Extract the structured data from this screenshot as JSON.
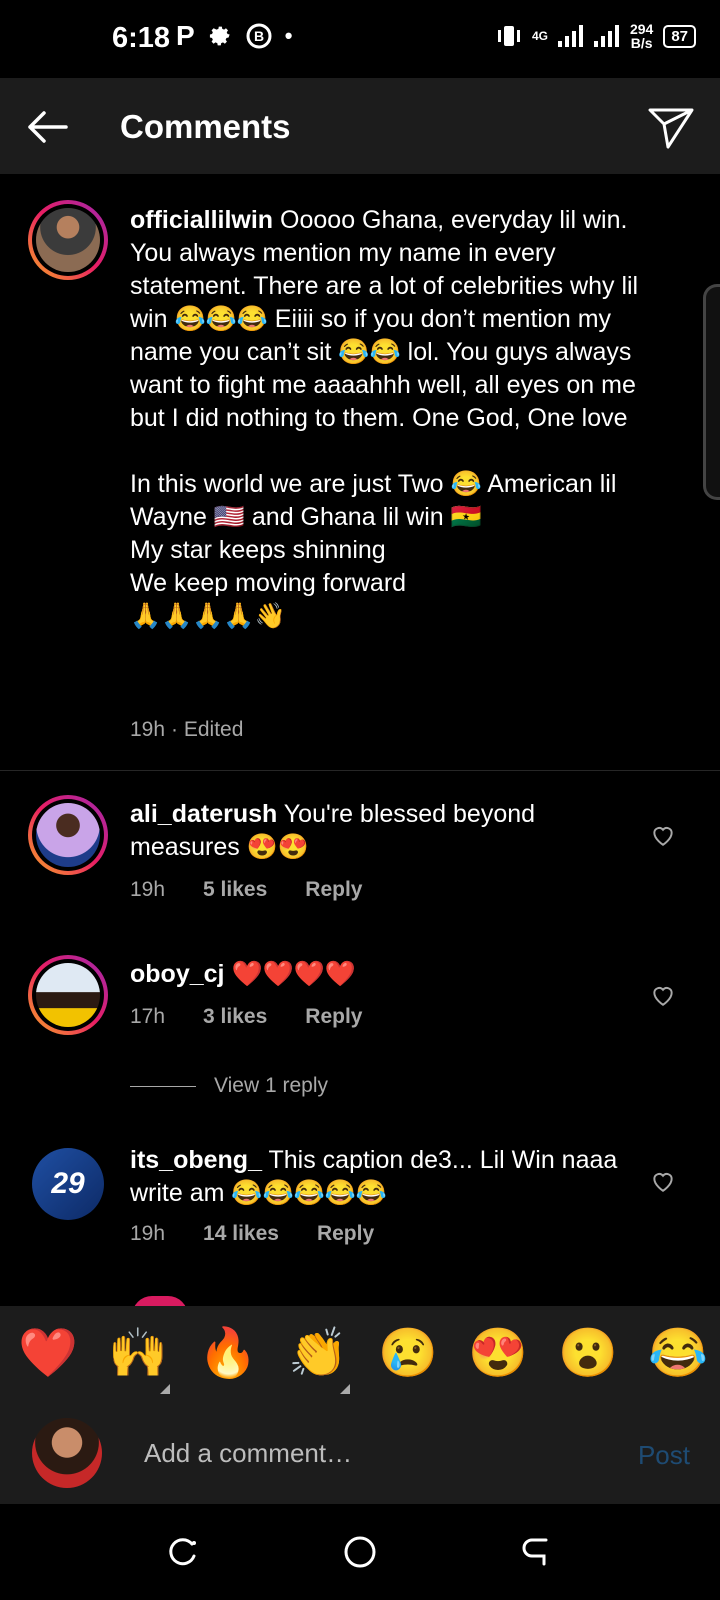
{
  "status_bar": {
    "time": "6:18",
    "left_icons": [
      "P",
      "gear-icon",
      "b-icon",
      "•"
    ],
    "network": "4G",
    "speed_value": "294",
    "speed_unit": "B/s",
    "battery": "87"
  },
  "header": {
    "title": "Comments"
  },
  "caption": {
    "username": "officiallilwin",
    "text": "Ooooo Ghana, everyday lil win. You always mention my name in every statement. There are a lot of celebrities why lil win 😂😂😂 Eiiii so if you don’t mention my name you can’t sit 😂😂 lol. You guys always want to fight me aaaahhh well, all eyes on me but I did nothing to them. One God, One love\n\nIn this world we are just Two 😂 American lil Wayne 🇺🇸 and Ghana lil win 🇬🇭\nMy star keeps shinning\nWe keep moving forward\n🙏🙏🙏🙏👋",
    "time": "19h",
    "edited": "· Edited"
  },
  "comments": [
    {
      "username": "ali_daterush",
      "text": "You're blessed beyond measures 😍😍",
      "time": "19h",
      "likes": "5 likes",
      "reply": "Reply"
    },
    {
      "username": "oboy_cj",
      "text": "❤️❤️❤️❤️",
      "time": "17h",
      "likes": "3 likes",
      "reply": "Reply"
    },
    {
      "username": "its_obeng_",
      "text": "This caption de3... Lil Win naaa write am 😂😂😂😂😂",
      "time": "19h",
      "likes": "14 likes",
      "reply": "Reply",
      "avatar_text": "29"
    }
  ],
  "view_replies": "View 1 reply",
  "reactions": [
    "❤️",
    "🙌",
    "🔥",
    "👏",
    "😢",
    "😍",
    "😮",
    "😂"
  ],
  "composer": {
    "placeholder": "Add a comment…",
    "post_label": "Post"
  },
  "colors": {
    "background": "#000000",
    "bar": "#1c1c1c",
    "meta_text": "#a8a8a8",
    "post_disabled": "#1e4b73"
  }
}
